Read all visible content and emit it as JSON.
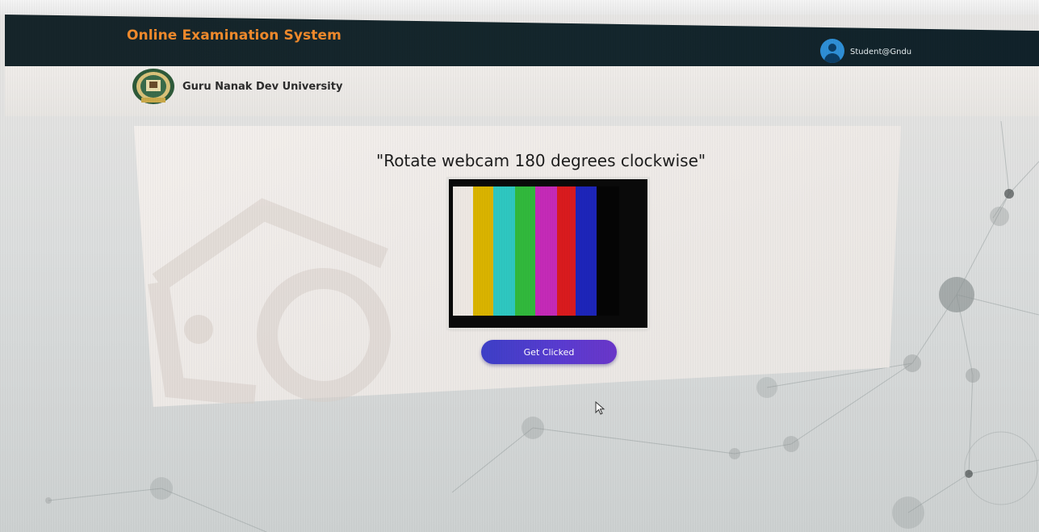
{
  "app": {
    "title": "Online Examination System",
    "user": "Student@Gndu",
    "university": "Guru Nanak Dev University"
  },
  "main": {
    "instruction": "\"Rotate webcam 180 degrees clockwise\"",
    "button_label": "Get Clicked"
  },
  "webcam_preview": {
    "bars": [
      "#ede7e2",
      "#d9b300",
      "#2ec7c0",
      "#31b83c",
      "#c42ab7",
      "#d91b1e",
      "#1d25b9",
      "#050505"
    ]
  },
  "colors": {
    "topbar": "#14262d",
    "title_accent": "#f08a2c",
    "button": "#4a3dcc"
  },
  "icons": {
    "avatar": "user-avatar-icon",
    "logo": "university-logo",
    "cursor": "mouse-pointer-icon"
  }
}
